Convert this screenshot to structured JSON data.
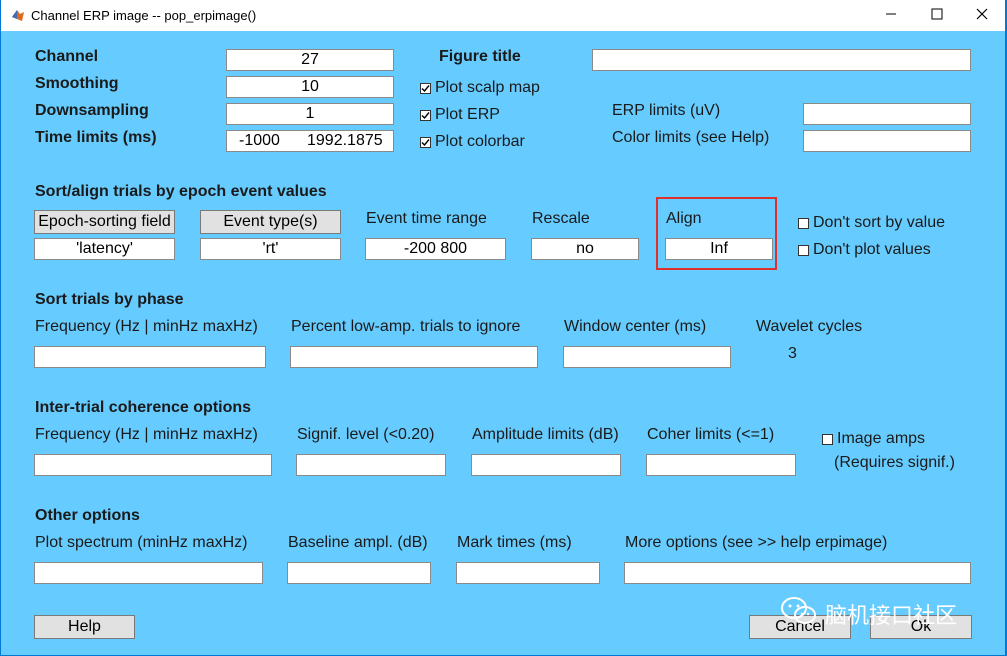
{
  "window": {
    "title": "Channel ERP image -- pop_erpimage()",
    "icon": "matlab-icon"
  },
  "basic": {
    "channel_label": "Channel",
    "channel_value": "27",
    "smoothing_label": "Smoothing",
    "smoothing_value": "10",
    "downsampling_label": "Downsampling",
    "downsampling_value": "1",
    "timelimits_label": "Time limits (ms)",
    "timelimits_start": "-1000",
    "timelimits_end": "1992.1875",
    "plot_scalp_label": "Plot scalp map",
    "plot_scalp_checked": true,
    "plot_erp_label": "Plot ERP",
    "plot_erp_checked": true,
    "plot_colorbar_label": "Plot colorbar",
    "plot_colorbar_checked": true,
    "figure_title_label": "Figure title",
    "figure_title_value": "",
    "erp_limits_label": "ERP limits (uV)",
    "erp_limits_value": "",
    "color_limits_label": "Color limits (see Help)",
    "color_limits_value": ""
  },
  "sort_align": {
    "heading": "Sort/align trials by epoch event values",
    "epoch_sorting_button": "Epoch-sorting field",
    "epoch_sorting_value": "'latency'",
    "event_type_button": "Event type(s)",
    "event_type_value": "'rt'",
    "event_time_range_label": "Event time range",
    "event_time_range_value": "-200  800",
    "rescale_label": "Rescale",
    "rescale_value": "no",
    "align_label": "Align",
    "align_value": "Inf",
    "dont_sort_label": "Don't sort by value",
    "dont_sort_checked": false,
    "dont_plot_label": "Don't plot values",
    "dont_plot_checked": false
  },
  "phase": {
    "heading": "Sort trials by phase",
    "frequency_label": "Frequency (Hz | minHz maxHz)",
    "frequency_value": "",
    "percent_label": "Percent low-amp. trials to ignore",
    "percent_value": "",
    "window_center_label": "Window center (ms)",
    "window_center_value": "",
    "wavelet_label": "Wavelet cycles",
    "wavelet_value": "3"
  },
  "coherence": {
    "heading": "Inter-trial coherence options",
    "frequency_label": "Frequency (Hz | minHz maxHz)",
    "frequency_value": "",
    "signif_label": "Signif. level (<0.20)",
    "signif_value": "",
    "amplitude_label": "Amplitude limits (dB)",
    "amplitude_value": "",
    "coher_label": "Coher limits (<=1)",
    "coher_value": "",
    "image_amps_label": "Image amps",
    "image_amps_checked": false,
    "requires_signif_label": "(Requires signif.)"
  },
  "other": {
    "heading": "Other options",
    "plot_spectrum_label": "Plot spectrum (minHz maxHz)",
    "plot_spectrum_value": "",
    "baseline_label": "Baseline ampl. (dB)",
    "baseline_value": "",
    "mark_times_label": "Mark times (ms)",
    "mark_times_value": "",
    "more_options_label": "More options (see >> help erpimage)",
    "more_options_value": ""
  },
  "buttons": {
    "help": "Help",
    "cancel": "Cancel",
    "ok": "Ok"
  },
  "watermark": {
    "text": "脑机接口社区",
    "icon": "wechat-icon"
  },
  "colors": {
    "background": "#66ccff",
    "highlight": "#e0302c"
  }
}
